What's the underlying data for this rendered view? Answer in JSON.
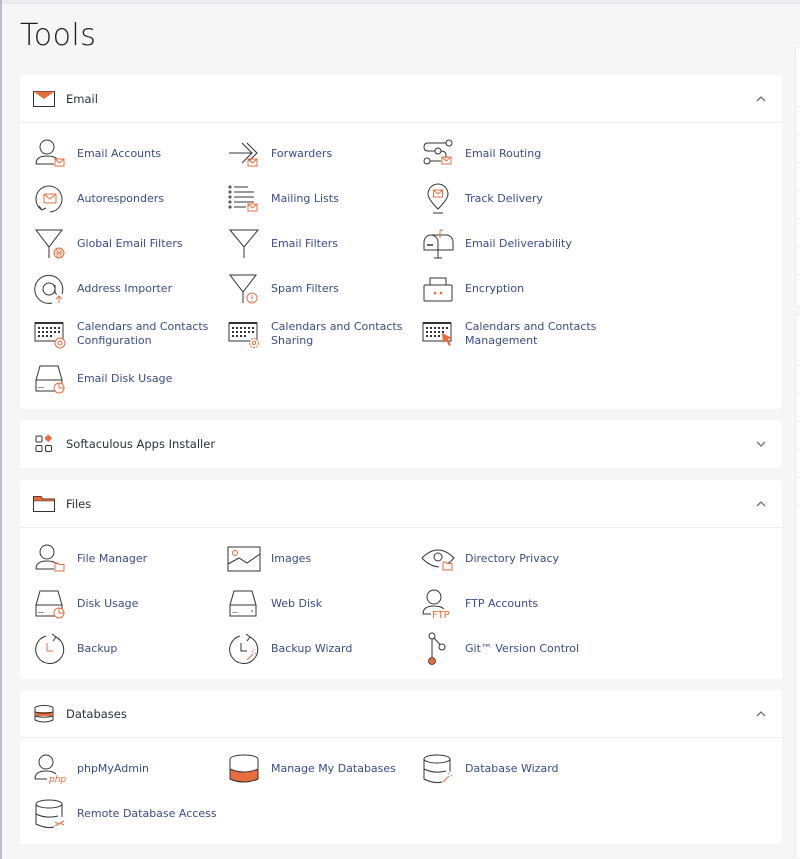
{
  "page": {
    "title": "Tools"
  },
  "colors": {
    "accent": "#e86d3c",
    "link": "#3d4b8a",
    "icon_stroke": "#333333"
  },
  "sections": [
    {
      "id": "email",
      "title": "Email",
      "icon": "envelope-icon",
      "expanded": true,
      "items": [
        {
          "label": "Email Accounts",
          "icon": "user-mail-icon"
        },
        {
          "label": "Forwarders",
          "icon": "forward-arrow-icon"
        },
        {
          "label": "Email Routing",
          "icon": "routing-icon"
        },
        {
          "label": "Autoresponders",
          "icon": "autoresponder-icon"
        },
        {
          "label": "Mailing Lists",
          "icon": "list-mail-icon"
        },
        {
          "label": "Track Delivery",
          "icon": "map-pin-mail-icon"
        },
        {
          "label": "Global Email Filters",
          "icon": "funnel-globe-icon"
        },
        {
          "label": "Email Filters",
          "icon": "funnel-icon"
        },
        {
          "label": "Email Deliverability",
          "icon": "mailbox-icon"
        },
        {
          "label": "Address Importer",
          "icon": "at-sign-icon"
        },
        {
          "label": "Spam Filters",
          "icon": "funnel-warning-icon"
        },
        {
          "label": "Encryption",
          "icon": "lock-box-icon"
        },
        {
          "label": "Calendars and Contacts\nConfiguration",
          "icon": "calendar-at-icon"
        },
        {
          "label": "Calendars and Contacts\nSharing",
          "icon": "calendar-gear-icon"
        },
        {
          "label": "Calendars and Contacts\nManagement",
          "icon": "calendar-cursor-icon"
        },
        {
          "label": "Email Disk Usage",
          "icon": "disk-pie-icon"
        }
      ]
    },
    {
      "id": "softaculous",
      "title": "Softaculous Apps Installer",
      "icon": "apps-grid-icon",
      "expanded": false,
      "items": []
    },
    {
      "id": "files",
      "title": "Files",
      "icon": "folder-icon",
      "expanded": true,
      "items": [
        {
          "label": "File Manager",
          "icon": "user-folder-icon"
        },
        {
          "label": "Images",
          "icon": "image-icon"
        },
        {
          "label": "Directory Privacy",
          "icon": "eye-folder-icon"
        },
        {
          "label": "Disk Usage",
          "icon": "disk-pie-icon"
        },
        {
          "label": "Web Disk",
          "icon": "disk-icon"
        },
        {
          "label": "FTP Accounts",
          "icon": "user-ftp-icon"
        },
        {
          "label": "Backup",
          "icon": "clock-restore-icon"
        },
        {
          "label": "Backup Wizard",
          "icon": "clock-wand-icon"
        },
        {
          "label": "Git™ Version Control",
          "icon": "git-branch-icon"
        }
      ]
    },
    {
      "id": "databases",
      "title": "Databases",
      "icon": "database-icon",
      "expanded": true,
      "items": [
        {
          "label": "phpMyAdmin",
          "icon": "user-php-icon"
        },
        {
          "label": "Manage My Databases",
          "icon": "database-filled-icon"
        },
        {
          "label": "Database Wizard",
          "icon": "database-wand-icon"
        },
        {
          "label": "Remote Database Access",
          "icon": "database-remote-icon"
        }
      ]
    }
  ]
}
